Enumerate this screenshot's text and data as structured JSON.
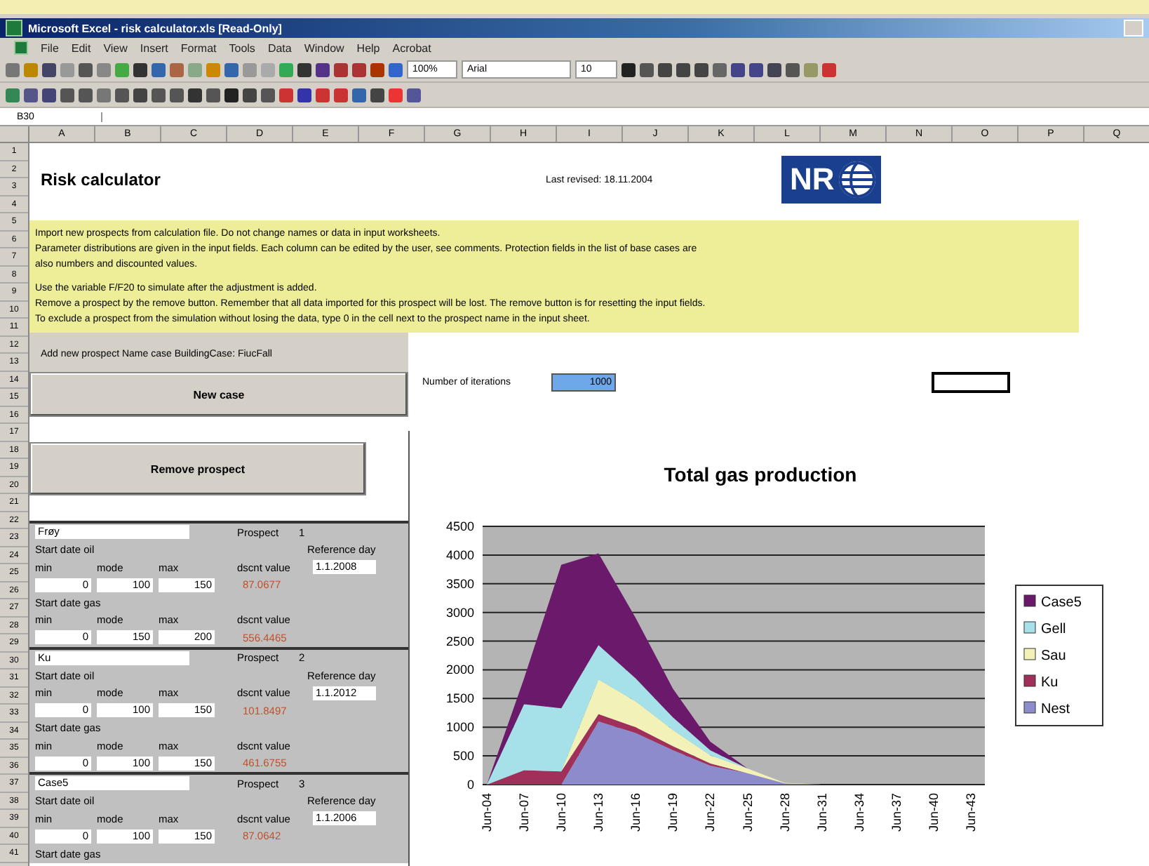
{
  "window": {
    "title": "Microsoft Excel - risk calculator.xls [Read-Only]"
  },
  "menu": [
    "File",
    "Edit",
    "View",
    "Insert",
    "Format",
    "Tools",
    "Data",
    "Window",
    "Help",
    "Acrobat"
  ],
  "toolbar": {
    "zoom": "100%",
    "font": "Arial",
    "size": "10"
  },
  "formula_bar": {
    "name_box": "B30"
  },
  "columns": [
    "A",
    "B",
    "C",
    "D",
    "E",
    "F",
    "G",
    "H",
    "I",
    "J",
    "K",
    "L",
    "M",
    "N",
    "O",
    "P",
    "Q"
  ],
  "row_numbers": [
    "1",
    "2",
    "3",
    "4",
    "5",
    "6",
    "7",
    "8",
    "9",
    "10",
    "11",
    "12",
    "13",
    "14",
    "15",
    "16",
    "17",
    "18",
    "19",
    "20",
    "21",
    "22",
    "23",
    "24",
    "25",
    "26",
    "27",
    "28",
    "29",
    "30",
    "31",
    "32",
    "33",
    "34",
    "35",
    "36",
    "37",
    "38",
    "39",
    "40",
    "41"
  ],
  "sheet": {
    "title": "Risk calculator",
    "revised": "Last revised: 18.11.2004",
    "logo": "NR",
    "notes": [
      [
        "Import new prospects from calculation file. Do not change names or data in input worksheets.",
        "Parameter distributions are given in the input fields. Each column can be edited by the user, see comments. Protection fields in the list of base cases are",
        "also numbers and discounted values."
      ],
      [
        "Use the variable F/F20 to simulate after the adjustment is added.",
        "Remove a prospect by the remove button. Remember that all data imported for this prospect will be lost. The remove button is for resetting the input fields.",
        "To exclude a prospect from the simulation without losing the data, type 0 in the cell next to the prospect name in the input sheet."
      ]
    ],
    "add_label": "Add new prospect   Name case BuildingCase: FiucFall",
    "buttons": [
      "New case",
      "Remove prospect"
    ],
    "iterations": {
      "label": "Number of iterations",
      "value": "1000"
    },
    "prospects": [
      {
        "name": "Frøy",
        "label": "Prospect",
        "number": "1",
        "oil": "Start date oil",
        "ref": "Reference day",
        "date": "1.1.2008",
        "min": "min",
        "mode": "mode",
        "max": "max",
        "dscnt": "dscnt value",
        "oil_values": [
          "0",
          "100",
          "150"
        ],
        "oil_result": "87.0677",
        "gas": "Start date gas",
        "gas_min": "min",
        "gas_mode": "mode",
        "gas_max": "max",
        "gas_dscnt": "dscnt value",
        "gas_values": [
          "0",
          "150",
          "200"
        ],
        "gas_result": "556.4465"
      },
      {
        "name": "Ku",
        "label": "Prospect",
        "number": "2",
        "oil": "Start date oil",
        "ref": "Reference day",
        "date": "1.1.2012",
        "min": "min",
        "mode": "mode",
        "max": "max",
        "dscnt": "dscnt value",
        "oil_values": [
          "0",
          "100",
          "150"
        ],
        "oil_result": "101.8497",
        "gas": "Start date gas",
        "gas_min": "min",
        "gas_mode": "mode",
        "gas_max": "max",
        "gas_dscnt": "dscnt value",
        "gas_values": [
          "0",
          "100",
          "150"
        ],
        "gas_result": "461.6755"
      },
      {
        "name": "Case5",
        "label": "Prospect",
        "number": "3",
        "oil": "Start date oil",
        "ref": "Reference day",
        "date": "1.1.2006",
        "min": "min",
        "mode": "mode",
        "max": "max",
        "dscnt": "dscnt value",
        "oil_values": [
          "0",
          "100",
          "150"
        ],
        "oil_result": "87.0642",
        "gas": "Start date gas"
      }
    ]
  },
  "chart_data": {
    "type": "area",
    "stacked": true,
    "title": "Total gas production",
    "categories": [
      "Jun-04",
      "Jun-07",
      "Jun-10",
      "Jun-13",
      "Jun-16",
      "Jun-19",
      "Jun-22",
      "Jun-25",
      "Jun-28",
      "Jun-31",
      "Jun-34",
      "Jun-37",
      "Jun-40",
      "Jun-43"
    ],
    "grid": true,
    "legend": "right",
    "ylim": [
      0,
      4500
    ],
    "yticks": [
      0,
      500,
      1000,
      1500,
      2000,
      2500,
      3000,
      3500,
      4000,
      4500
    ],
    "series": [
      {
        "name": "Nest",
        "color": "#8c8ccc",
        "values": [
          0,
          0,
          0,
          1100,
          900,
          600,
          330,
          200,
          20,
          0,
          0,
          0,
          0,
          0
        ]
      },
      {
        "name": "Ku",
        "color": "#a0305a",
        "values": [
          0,
          250,
          230,
          130,
          100,
          70,
          40,
          0,
          0,
          0,
          0,
          0,
          0,
          0
        ]
      },
      {
        "name": "Sau",
        "color": "#f2f2b8",
        "values": [
          0,
          0,
          0,
          600,
          450,
          280,
          140,
          80,
          10,
          0,
          0,
          0,
          0,
          0
        ]
      },
      {
        "name": "Gell",
        "color": "#a6e0e8",
        "values": [
          0,
          1150,
          1100,
          600,
          400,
          220,
          90,
          0,
          0,
          0,
          0,
          0,
          0,
          0
        ]
      },
      {
        "name": "Case5",
        "color": "#6b1a6b",
        "values": [
          0,
          450,
          2500,
          1600,
          1050,
          500,
          150,
          0,
          0,
          0,
          0,
          0,
          0,
          0
        ]
      }
    ]
  }
}
